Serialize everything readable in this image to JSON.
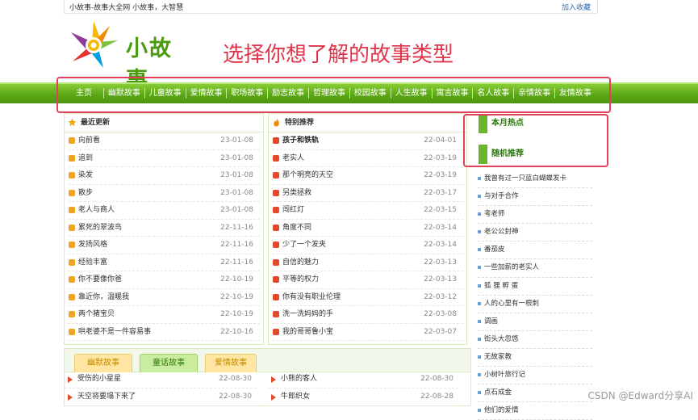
{
  "topbar": {
    "site_title": "小故事-故事大全网 小故事，大智慧",
    "favorite": "加入收藏"
  },
  "logo": {
    "text": "小故事"
  },
  "headline": "选择你想了解的故事类型",
  "nav": {
    "home": "主页",
    "items": [
      "幽默故事",
      "儿童故事",
      "爱情故事",
      "职场故事",
      "励志故事",
      "哲理故事",
      "校园故事",
      "人生故事",
      "寓言故事",
      "名人故事",
      "亲情故事",
      "友情故事"
    ]
  },
  "latest": {
    "title": "最近更新",
    "items": [
      {
        "t": "向前看",
        "d": "23-01-08"
      },
      {
        "t": "追到",
        "d": "23-01-08"
      },
      {
        "t": "染发",
        "d": "23-01-08"
      },
      {
        "t": "散步",
        "d": "23-01-08"
      },
      {
        "t": "老人与商人",
        "d": "23-01-08"
      },
      {
        "t": "累死的翠波鸟",
        "d": "22-11-16"
      },
      {
        "t": "发扬风格",
        "d": "22-11-16"
      },
      {
        "t": "经验丰富",
        "d": "22-11-16"
      },
      {
        "t": "你不要像你爸",
        "d": "22-10-19"
      },
      {
        "t": "靠近你，温暖我",
        "d": "22-10-19"
      },
      {
        "t": "两个猪宝贝",
        "d": "22-10-19"
      },
      {
        "t": "哄老婆不是一件容易事",
        "d": "22-10-16"
      }
    ]
  },
  "featured": {
    "title": "特别推荐",
    "items": [
      {
        "t": "孩子和铁轨",
        "d": "22-04-01",
        "bold": true
      },
      {
        "t": "老实人",
        "d": "22-03-19"
      },
      {
        "t": "那个明亮的天空",
        "d": "22-03-19"
      },
      {
        "t": "另类拯救",
        "d": "22-03-17"
      },
      {
        "t": "闯红灯",
        "d": "22-03-15"
      },
      {
        "t": "角度不同",
        "d": "22-03-14"
      },
      {
        "t": "少了一个发夹",
        "d": "22-03-14"
      },
      {
        "t": "自信的魅力",
        "d": "22-03-13"
      },
      {
        "t": "平等的权力",
        "d": "22-03-13"
      },
      {
        "t": "你有没有职业伦理",
        "d": "22-03-12"
      },
      {
        "t": "洗一洗妈妈的手",
        "d": "22-03-08"
      },
      {
        "t": "我的哥哥鲁小宝",
        "d": "22-03-07"
      }
    ]
  },
  "sidebar": {
    "hot_title": "本月热点",
    "random_title": "随机推荐",
    "items": [
      "我曾有过一只蓝白蝴蝶发卡",
      "与对手合作",
      "考老师",
      "老公公封神",
      "番茄皮",
      "一些加薪的老实人",
      "狐 狸 孵 蛋",
      "人的心里有一根刺",
      "调画",
      "街头大忽悠",
      "无故家教",
      "小树叶旅行记",
      "点石成金",
      "他们的爱情"
    ]
  },
  "tabs": [
    "幽默故事",
    "童话故事",
    "爱情故事"
  ],
  "bottom": {
    "left": [
      {
        "t": "受伤的小星星",
        "d": "22-08-30"
      },
      {
        "t": "天空将要塌下来了",
        "d": "22-08-30"
      }
    ],
    "right": [
      {
        "t": "小熊的客人",
        "d": "22-08-30"
      },
      {
        "t": "牛郎织女",
        "d": "22-08-28"
      }
    ]
  },
  "watermark": "CSDN @Edward分享AI",
  "colors": {
    "nav_green": "#5aa815",
    "headline_red": "#e0344a",
    "highlight_box": "#e2405c"
  }
}
